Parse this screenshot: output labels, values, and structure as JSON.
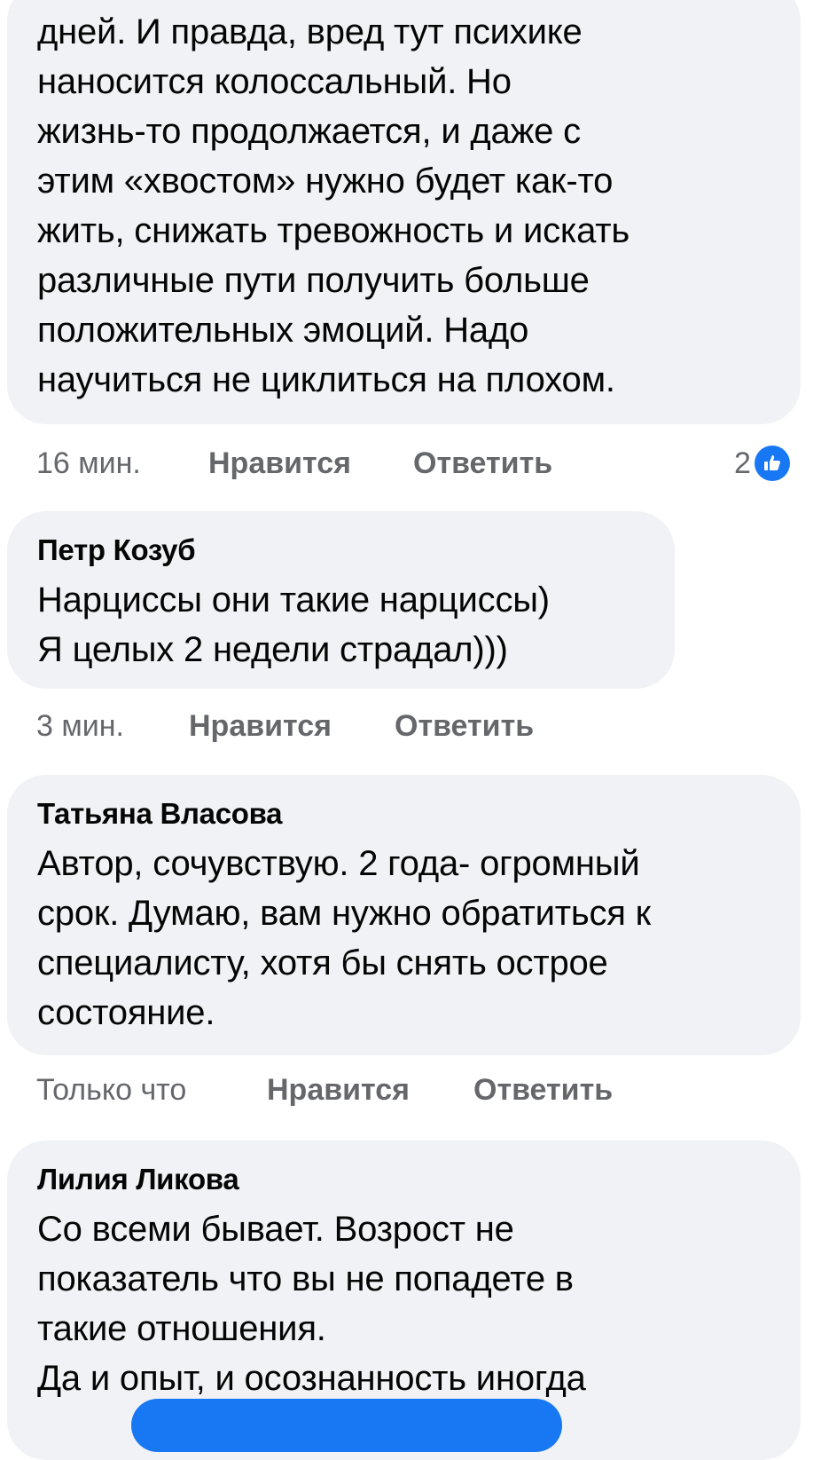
{
  "comments": [
    {
      "author": "",
      "text_lines": [
        "дней. И правда, вред тут психике",
        "наносится колоссальный. Но",
        "жизнь-то продолжается, и даже с",
        "этим «хвостом» нужно будет как-то",
        "жить, снижать тревожность и искать",
        "различные пути получить больше",
        "положительных эмоций. Надо",
        "научиться не циклиться на плохом."
      ],
      "time": "16 мин.",
      "like_label": "Нравится",
      "reply_label": "Ответить",
      "reaction_count": "2"
    },
    {
      "author": "Петр Козуб",
      "text_lines": [
        "Нарциссы они такие нарциссы)",
        "Я целых 2 недели страдал)))"
      ],
      "time": "3 мин.",
      "like_label": "Нравится",
      "reply_label": "Ответить"
    },
    {
      "author": "Татьяна Власова",
      "text_lines": [
        "Автор, сочувствую. 2 года- огромный",
        "срок. Думаю, вам нужно обратиться к",
        "специалисту, хотя бы снять острое",
        "состояние."
      ],
      "time": "Только что",
      "like_label": "Нравится",
      "reply_label": "Ответить"
    },
    {
      "author": "Лилия Ликова",
      "text_lines": [
        "Со всеми бывает. Возрост не",
        "показатель что вы не попадете в",
        "такие отношения.",
        "Да и опыт, и осознанность иногда"
      ]
    }
  ],
  "icons": {
    "reaction": "like-thumbs-up-icon"
  },
  "colors": {
    "bubble": "#f0f2f5",
    "meta_text": "#65676b",
    "accent": "#1877f2"
  }
}
